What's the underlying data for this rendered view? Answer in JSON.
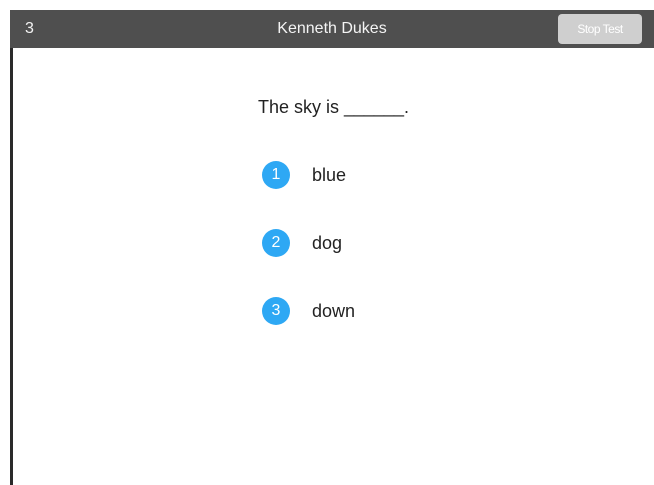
{
  "header": {
    "question_number": "3",
    "student_name": "Kenneth Dukes",
    "stop_button_label": "Stop Test"
  },
  "question": {
    "prompt": "The sky is ______."
  },
  "options": [
    {
      "number": "1",
      "label": "blue"
    },
    {
      "number": "2",
      "label": "dog"
    },
    {
      "number": "3",
      "label": "down"
    }
  ],
  "colors": {
    "header_background": "#4f4f4f",
    "button_background": "#cfcfcf",
    "option_badge": "#2ea8f4"
  }
}
